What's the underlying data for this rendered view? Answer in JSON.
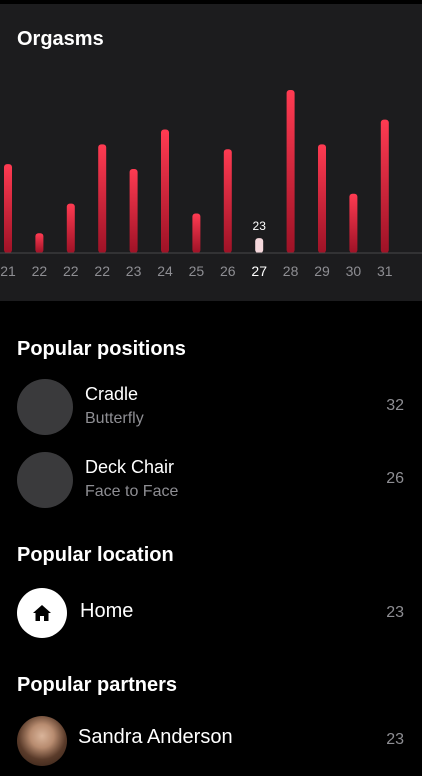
{
  "chart": {
    "title": "Orgasms"
  },
  "chart_data": {
    "type": "bar",
    "categories": [
      "21",
      "22",
      "22",
      "22",
      "23",
      "24",
      "25",
      "26",
      "27",
      "28",
      "29",
      "30",
      "31"
    ],
    "values": [
      18,
      4,
      10,
      22,
      17,
      25,
      8,
      21,
      3,
      33,
      22,
      12,
      27
    ],
    "selected_index": 8,
    "selected_value_label": "23"
  },
  "positions": {
    "title": "Popular positions",
    "items": [
      {
        "name": "Cradle",
        "category": "Butterfly",
        "count": "32"
      },
      {
        "name": "Deck Chair",
        "category": "Face to Face",
        "count": "26"
      }
    ]
  },
  "location": {
    "title": "Popular location",
    "items": [
      {
        "name": "Home",
        "count": "23",
        "icon": "home-icon"
      }
    ]
  },
  "partners": {
    "title": "Popular partners",
    "items": [
      {
        "name": "Sandra Anderson",
        "count": "23"
      }
    ]
  },
  "colors": {
    "bar_top": "#ff3b52",
    "bar_bottom": "#9e1226",
    "selected_bar": "#f5d8dc",
    "card_bg": "#1c1c1e",
    "muted_text": "#8e8e93"
  }
}
